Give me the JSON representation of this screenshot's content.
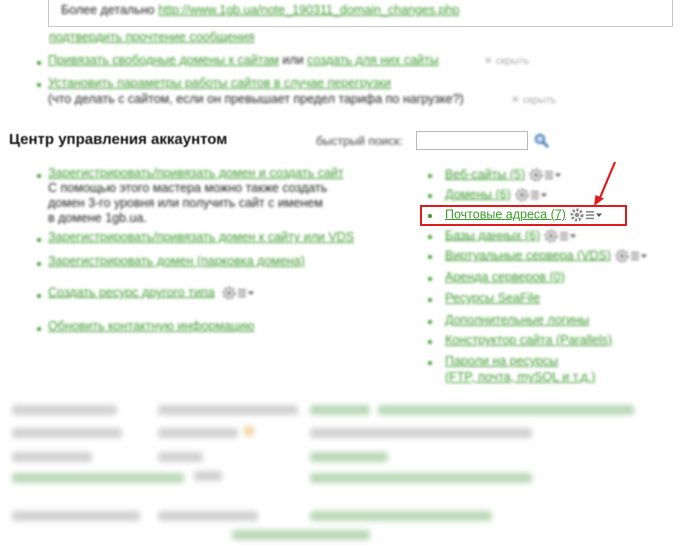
{
  "notice": {
    "prefix": "Более детально ",
    "link": "http://www.1gb.ua/note_190311_domain_changes.php",
    "confirm_link": "подтвердить прочтение сообщения"
  },
  "tips": [
    {
      "link": "Привязать свободные домены к сайтам",
      "middle": " или ",
      "link2": "создать для них сайты",
      "hide": "✕ скрыть"
    },
    {
      "link": "Установить параметры работы сайтов в случае перегрузки",
      "note": "(что делать с сайтом, если он превышает предел тарифа по нагрузке?)",
      "hide": "✕ скрыть"
    }
  ],
  "account": {
    "title": "Центр управления аккаунтом",
    "search_label": "быстрый поиск:",
    "search_value": "",
    "search_placeholder": ""
  },
  "left_actions": [
    {
      "link": "Зарегистрировать/привязать домен и создать сайт",
      "desc": [
        "С помощью этого мастера можно также создать",
        "домен 3-го уровня или получить сайт с именем",
        "в домене 1gb.ua."
      ]
    },
    {
      "link": "Зарегистрировать/привязать домен к сайту или VDS"
    },
    {
      "link": "Зарегистрировать домен (парковка домена)"
    },
    {
      "link": "Создать ресурс другого типа"
    },
    {
      "link": "Обновить контактную информацию"
    }
  ],
  "resources": [
    {
      "label": "Веб-сайты (5)",
      "gear": true
    },
    {
      "label": "Домены (6)",
      "gear": true
    },
    {
      "label": "Почтовые адреса (7)",
      "gear": true,
      "highlighted": true
    },
    {
      "label": "Базы данных (6)",
      "gear": true
    },
    {
      "label": "Виртуальные сервера (VDS)",
      "gear": true
    },
    {
      "label": "Аренда серверов (0)",
      "gear": false
    },
    {
      "label": "Ресурсы SeaFile",
      "gear": false
    },
    {
      "label": "Дополнительные логины",
      "gear": false
    },
    {
      "label": "Конструктор сайта (Parallels)",
      "gear": false
    },
    {
      "label": "Пароли на ресурсы",
      "label2": "(FTP, почта, mySQL и т.д.)",
      "gear": false
    }
  ],
  "colors": {
    "link": "#3d9a2e",
    "highlight": "#e01b1b",
    "gear": "#8a8a8a"
  },
  "icons": {
    "search": "magnifier-icon",
    "gear": "gear-icon",
    "dropdown": "caret-down-icon",
    "arrow": "red-arrow-annotation"
  }
}
